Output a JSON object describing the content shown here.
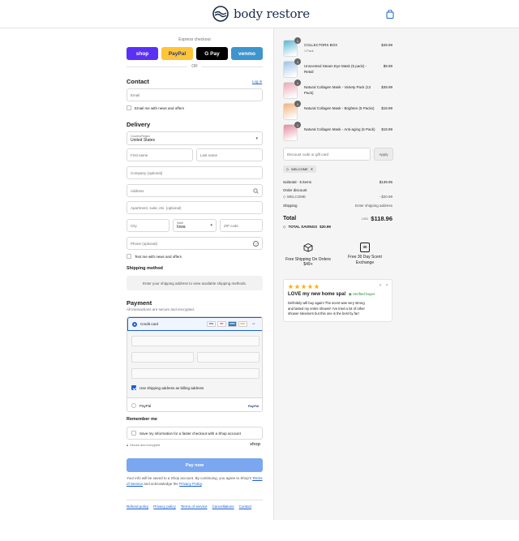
{
  "brand": {
    "name": "body restore"
  },
  "express": {
    "label": "Express checkout",
    "buttons": [
      {
        "label": "shop",
        "color": "#5a31f4",
        "text_color": "#ffffff"
      },
      {
        "label": "PayPal",
        "color": "#ffc439",
        "text_color": "#253b80"
      },
      {
        "label": "G Pay",
        "color": "#000000",
        "text_color": "#ffffff"
      },
      {
        "label": "venmo",
        "color": "#3d95ce",
        "text_color": "#ffffff"
      }
    ],
    "or": "OR"
  },
  "contact": {
    "heading": "Contact",
    "login": "Log in",
    "email_placeholder": "Email",
    "news_checkbox": "Email me with news and offers"
  },
  "delivery": {
    "heading": "Delivery",
    "country_label": "Country/Region",
    "country_value": "United States",
    "first_name": "First name",
    "last_name": "Last name",
    "company": "Company (optional)",
    "address": "Address",
    "apartment": "Apartment, suite, etc. (optional)",
    "city": "City",
    "state_label": "State",
    "state_value": "Iowa",
    "zip": "ZIP code",
    "phone": "Phone (optional)",
    "text_checkbox": "Text me with news and offers"
  },
  "shipping": {
    "heading": "Shipping method",
    "info": "Enter your shipping address to view available shipping methods."
  },
  "payment": {
    "heading": "Payment",
    "sub": "All transactions are secure and encrypted.",
    "credit_card": "Credit card",
    "cards": [
      {
        "label": "VISA",
        "bg": "#ffffff",
        "fg": "#1a1f71"
      },
      {
        "label": "MC",
        "bg": "#ffffff",
        "fg": "#eb001b"
      },
      {
        "label": "AMEX",
        "bg": "#2e77bb",
        "fg": "#ffffff"
      },
      {
        "label": "DISC",
        "bg": "#ffffff",
        "fg": "#f58220"
      }
    ],
    "more_cards": "+4",
    "billing_checkbox": "Use shipping address as billing address",
    "paypal": "PayPal",
    "paypal_logo": "PayPal"
  },
  "remember": {
    "heading": "Remember me",
    "checkbox": "Save my information for a faster checkout with a Shop account",
    "secure": "Secure and encrypted",
    "shop": "shop"
  },
  "pay_now": "Pay now",
  "legal": {
    "text1": "Your info will be saved to a Shop account. By continuing, you agree to Shop's",
    "terms": "Terms of Service",
    "text2": "and acknowledge the",
    "privacy": "Privacy Policy",
    "text3": "."
  },
  "footer": [
    "Refund policy",
    "Privacy policy",
    "Terms of service",
    "Cancellations",
    "Contact"
  ],
  "cart": {
    "items": [
      {
        "name": "COLLECTORS BOX",
        "variant": "1 Pack",
        "qty": "1",
        "price": "$49.99",
        "color": "#5bb6d3"
      },
      {
        "name": "Unscented Steam Eye Mask (5 pack) - Retail",
        "variant": "",
        "qty": "1",
        "price": "$9.99",
        "color": "#9fc3e6"
      },
      {
        "name": "Natural Collagen Mask - Variety Pack (12 Pack)",
        "variant": "",
        "qty": "1",
        "price": "$39.99",
        "color": "#e9a9b5"
      },
      {
        "name": "Natural Collagen Mask - Brighten (5 Packs)",
        "variant": "",
        "qty": "1",
        "price": "$19.99",
        "color": "#f1b37c"
      },
      {
        "name": "Natural Collagen Mask - Anti-aging (5 Pack)",
        "variant": "",
        "qty": "1",
        "price": "$19.99",
        "color": "#e48aa0"
      }
    ],
    "discount_placeholder": "Discount code or gift card",
    "apply": "Apply",
    "tag": "WELCOME",
    "subtotal_label": "Subtotal · 5 items",
    "subtotal": "$139.95",
    "order_discount": "Order discount",
    "discount_code": "WELCOME",
    "discount_value": "- $20.99",
    "shipping_label": "Shipping",
    "shipping_value": "Enter shipping address",
    "total_label": "Total",
    "currency": "USD",
    "total": "$118.96",
    "savings_label": "TOTAL SAVINGS",
    "savings": "$20.99"
  },
  "perks": [
    {
      "text": "Free Shipping On Orders $49+",
      "icon": "box-icon"
    },
    {
      "text": "Free 30 Day Scent Exchange",
      "icon": "calendar-icon",
      "badge": "30"
    }
  ],
  "review": {
    "rating": 5,
    "title": "LOVE my new home spa!",
    "verified": "Verified buyer",
    "text": "Definitely will buy again! The scent was very strong and lasted my entire shower! I've tried a lot of other shower steamers but this one is the best by far!"
  }
}
